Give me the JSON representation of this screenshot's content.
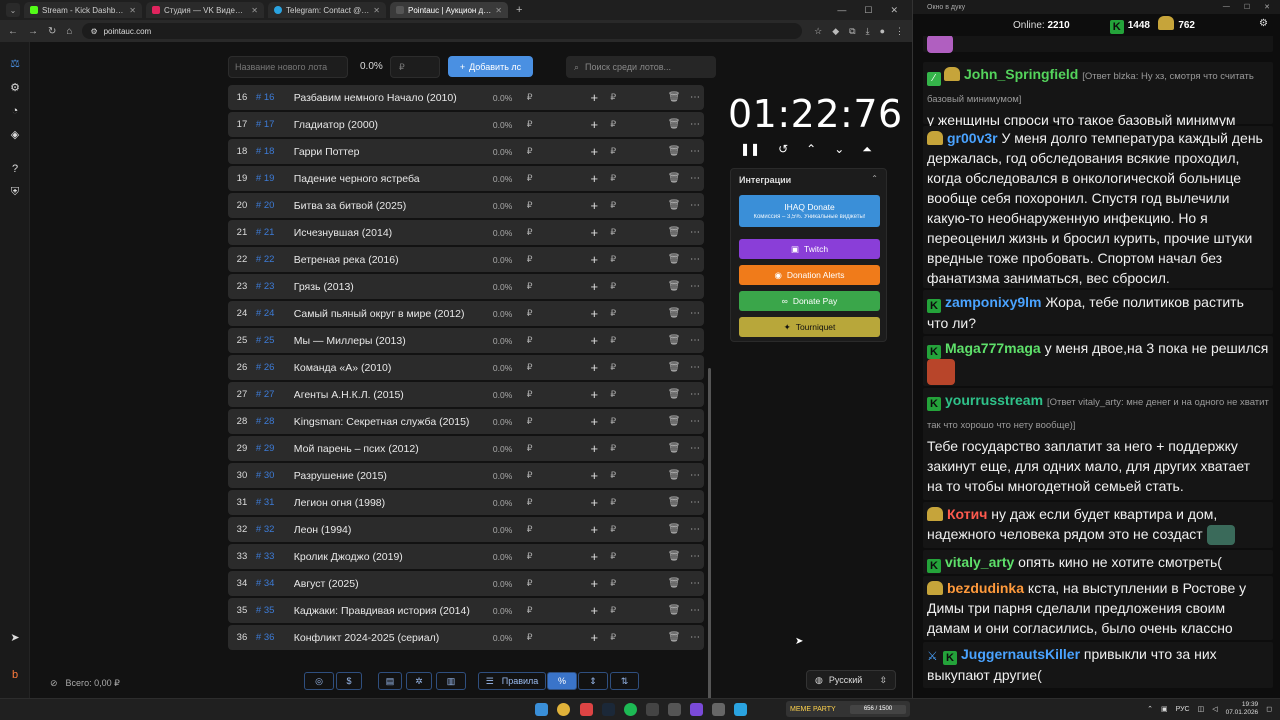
{
  "browser": {
    "tabs": [
      {
        "title": "Stream - Kick Dashboard",
        "color": "#53fc18"
      },
      {
        "title": "Студия — VK Видео Live",
        "color": "#e0245e"
      },
      {
        "title": "Telegram: Contact @boris_roch",
        "color": "#2aa3e0"
      },
      {
        "title": "Pointauc | Аукцион для стрим",
        "color": "#555555"
      }
    ],
    "url": "pointauc.com"
  },
  "top_controls": {
    "lot_placeholder": "Название нового лота",
    "percent": "0.0%",
    "currency": "₽",
    "add_label": "Добавить лс",
    "search_placeholder": "Поиск среди лотов..."
  },
  "lots": [
    {
      "n": "16",
      "hash": "# 16",
      "title": "Разбавим немного Начало (2010)",
      "pct": "0.0%",
      "rub": "₽"
    },
    {
      "n": "17",
      "hash": "# 17",
      "title": "Гладиатор (2000)",
      "pct": "0.0%",
      "rub": "₽"
    },
    {
      "n": "18",
      "hash": "# 18",
      "title": "Гарри Поттер",
      "pct": "0.0%",
      "rub": "₽"
    },
    {
      "n": "19",
      "hash": "# 19",
      "title": "Падение черного ястреба",
      "pct": "0.0%",
      "rub": "₽"
    },
    {
      "n": "20",
      "hash": "# 20",
      "title": "Битва за битвой (2025)",
      "pct": "0.0%",
      "rub": "₽"
    },
    {
      "n": "21",
      "hash": "# 21",
      "title": "Исчезнувшая (2014)",
      "pct": "0.0%",
      "rub": "₽"
    },
    {
      "n": "22",
      "hash": "# 22",
      "title": "Ветреная река (2016)",
      "pct": "0.0%",
      "rub": "₽"
    },
    {
      "n": "23",
      "hash": "# 23",
      "title": "Грязь (2013)",
      "pct": "0.0%",
      "rub": "₽"
    },
    {
      "n": "24",
      "hash": "# 24",
      "title": "Самый пьяный округ в мире (2012)",
      "pct": "0.0%",
      "rub": "₽"
    },
    {
      "n": "25",
      "hash": "# 25",
      "title": "Мы — Миллеры (2013)",
      "pct": "0.0%",
      "rub": "₽"
    },
    {
      "n": "26",
      "hash": "# 26",
      "title": "Команда «А» (2010)",
      "pct": "0.0%",
      "rub": "₽"
    },
    {
      "n": "27",
      "hash": "# 27",
      "title": "Агенты А.Н.К.Л. (2015)",
      "pct": "0.0%",
      "rub": "₽"
    },
    {
      "n": "28",
      "hash": "# 28",
      "title": "Kingsman: Секретная служба (2015)",
      "pct": "0.0%",
      "rub": "₽"
    },
    {
      "n": "29",
      "hash": "# 29",
      "title": "Мой парень – псих (2012)",
      "pct": "0.0%",
      "rub": "₽"
    },
    {
      "n": "30",
      "hash": "# 30",
      "title": "Разрушение (2015)",
      "pct": "0.0%",
      "rub": "₽"
    },
    {
      "n": "31",
      "hash": "# 31",
      "title": "Легион огня (1998)",
      "pct": "0.0%",
      "rub": "₽"
    },
    {
      "n": "32",
      "hash": "# 32",
      "title": "Леон (1994)",
      "pct": "0.0%",
      "rub": "₽"
    },
    {
      "n": "33",
      "hash": "# 33",
      "title": "Кролик Джоджо (2019)",
      "pct": "0.0%",
      "rub": "₽"
    },
    {
      "n": "34",
      "hash": "# 34",
      "title": "Август (2025)",
      "pct": "0.0%",
      "rub": "₽"
    },
    {
      "n": "35",
      "hash": "# 35",
      "title": "Каджаки: Правдивая история (2014)",
      "pct": "0.0%",
      "rub": "₽"
    },
    {
      "n": "36",
      "hash": "# 36",
      "title": "Конфликт 2024-2025 (сериал)",
      "pct": "0.0%",
      "rub": "₽"
    }
  ],
  "timer": {
    "value": "01:22:76"
  },
  "integrations": {
    "title": "Интеграции",
    "ihaq": "IHAQ Donate",
    "ihaq_sub": "Комиссия – 3,5%. Уникальные виджеты!",
    "twitch": "Twitch",
    "donation_alerts": "Donation Alerts",
    "donate_pay": "Donate Pay",
    "tourniquet": "Tourniquet"
  },
  "bottom": {
    "total": "Всего: 0,00 ₽",
    "rules": "Правила",
    "percent_btn": "%",
    "language": "Русский"
  },
  "chat": {
    "window_title": "Окно в дуку",
    "online_label": "Online:",
    "online": "2210",
    "kick_count": "1448",
    "other_count": "762",
    "messages": [
      {
        "user": "John_Springfield",
        "color": "#54d35c",
        "reply": "[Ответ blzka: Ну хз, смотря что считать базовый минимумом]",
        "text": "у женщины спроси что такое базовый минимум"
      },
      {
        "user": "gr00v3r",
        "color": "#4aa3ff",
        "reply": "",
        "text": "У меня долго температура каждый день держалась, год обследования всякие проходил, когда обследовался в онкологической больнице вообще себя похоронил. Спустя год вылечили какую-то необнаруженную инфекцию. Но я переоценил жизнь и бросил курить, прочие штуки вредные тоже пробовать. Спортом начал без фанатизма заниматься, вес сбросил."
      },
      {
        "user": "zamponixy9lm",
        "color": "#4aa3ff",
        "reply": "",
        "text": "Жора, тебе политиков растить что ли?"
      },
      {
        "user": "Maga777maga",
        "color": "#5ee06a",
        "reply": "",
        "text": "у меня двое,на 3 пока не решился"
      },
      {
        "user": "yourrusstream",
        "color": "#2fc28a",
        "reply": "[Ответ vitaly_arty: мне денег и на одного не хватит так что хорошо что нету вообще)]",
        "text": "Тебе государство заплатит за него + поддержку закинут еще, для одних мало, для других хватает на то чтобы многодетной семьей стать."
      },
      {
        "user": "Котич",
        "color": "#ff5a4e",
        "reply": "",
        "text": "ну даж если будет квартира и дом, надежного человека рядом это не создаст"
      },
      {
        "user": "vitaly_arty",
        "color": "#5ee06a",
        "reply": "",
        "text": "опять кино не хотите смотреть("
      },
      {
        "user": "bezdudinka",
        "color": "#ff9a3c",
        "reply": "",
        "text": "кста, на выступлении в Ростове у Димы три парня сделали предложения своим дамам и они согласились, было очень классно"
      },
      {
        "user": "JuggernautsKiller",
        "color": "#4aa3ff",
        "reply": "",
        "text": "привыкли что за них выкупают другие("
      }
    ]
  },
  "taskbar": {
    "meme_label": "MEME PARTY",
    "meme_progress": "656 / 1500",
    "lang": "РУС",
    "time": "19:39",
    "date": "07.01.2026"
  }
}
